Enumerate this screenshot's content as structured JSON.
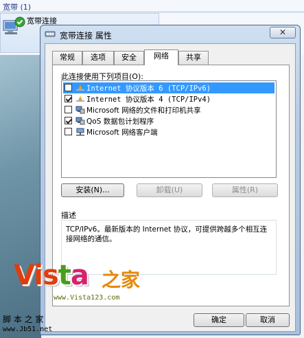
{
  "background": {
    "group_header": "宽带 (1)",
    "item_label": "宽带连接",
    "item_sub": "宽带连接"
  },
  "window": {
    "title": "宽带连接 属性",
    "close_glyph": "✕",
    "tabs": [
      {
        "label": "常规"
      },
      {
        "label": "选项"
      },
      {
        "label": "安全"
      },
      {
        "label": "网络"
      },
      {
        "label": "共享"
      }
    ],
    "active_tab": "网络",
    "connection_label": "此连接使用下列项目(O):",
    "items": [
      {
        "checked": false,
        "selected": true,
        "icon": "protocol-icon",
        "text": "Internet 协议版本 6 (TCP/IPv6)"
      },
      {
        "checked": true,
        "selected": false,
        "icon": "protocol-icon",
        "text": "Internet 协议版本 4 (TCP/IPv4)"
      },
      {
        "checked": false,
        "selected": false,
        "icon": "network-service-icon",
        "text": "Microsoft 网络的文件和打印机共享"
      },
      {
        "checked": true,
        "selected": false,
        "icon": "network-service-icon",
        "text": "QoS 数据包计划程序"
      },
      {
        "checked": false,
        "selected": false,
        "icon": "network-client-icon",
        "text": "Microsoft 网络客户端"
      }
    ],
    "buttons": {
      "install": "安装(N)...",
      "uninstall": "卸载(U)",
      "properties": "属性(R)"
    },
    "description_title": "描述",
    "description_text": "TCP/IPv6。最新版本的 Internet 协议，可提供跨越多个相互连接网络的通信。",
    "ok": "确定",
    "cancel": "取消"
  },
  "watermark": {
    "logo_v": "V",
    "logo_i": "i",
    "logo_s": "s",
    "logo_t": "t",
    "logo_a": "a",
    "logo_cn": "之家",
    "url": "www.Vista123.com",
    "site2": "脚 本 之 家",
    "site2_url": "www.Jb51.net"
  }
}
